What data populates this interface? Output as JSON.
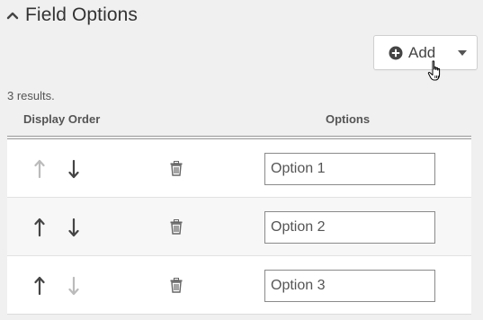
{
  "section": {
    "title": "Field Options",
    "collapse_icon": "chevron-up-icon"
  },
  "add_button": {
    "label": "Add",
    "icon": "plus-circle-icon",
    "dropdown_icon": "caret-down-icon"
  },
  "results_text": "3 results.",
  "columns": {
    "display_order": "Display Order",
    "options": "Options"
  },
  "rows": [
    {
      "value": "Option 1",
      "up_enabled": false,
      "down_enabled": true
    },
    {
      "value": "Option 2",
      "up_enabled": true,
      "down_enabled": true
    },
    {
      "value": "Option 3",
      "up_enabled": true,
      "down_enabled": false
    }
  ],
  "colors": {
    "arrow_enabled": "#444444",
    "arrow_disabled": "#bbbbbb",
    "trash": "#666666",
    "icon_dark": "#444444"
  }
}
